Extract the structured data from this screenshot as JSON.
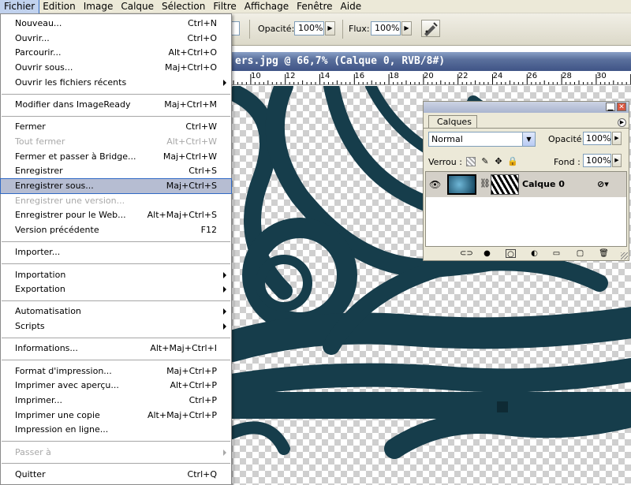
{
  "menubar": [
    {
      "label": "Fichier",
      "active": true
    },
    {
      "label": "Edition"
    },
    {
      "label": "Image"
    },
    {
      "label": "Calque"
    },
    {
      "label": "Sélection"
    },
    {
      "label": "Filtre"
    },
    {
      "label": "Affichage"
    },
    {
      "label": "Fenêtre"
    },
    {
      "label": "Aide"
    }
  ],
  "options": {
    "opacity_label": "Opacité:",
    "opacity_value": "100%",
    "flow_label": "Flux:",
    "flow_value": "100%",
    "airbrush_icon": "airbrush-icon"
  },
  "document": {
    "title": "ers.jpg @ 66,7% (Calque 0, RVB/8#)",
    "ruler_ticks": [
      "10",
      "12",
      "14",
      "16",
      "18",
      "20",
      "22",
      "24",
      "26",
      "28",
      "30"
    ]
  },
  "file_menu": [
    {
      "label": "Nouveau...",
      "shortcut": "Ctrl+N"
    },
    {
      "label": "Ouvrir...",
      "shortcut": "Ctrl+O"
    },
    {
      "label": "Parcourir...",
      "shortcut": "Alt+Ctrl+O"
    },
    {
      "label": "Ouvrir sous...",
      "shortcut": "Maj+Ctrl+O"
    },
    {
      "label": "Ouvrir les fichiers récents",
      "submenu": true
    },
    {
      "separator": true
    },
    {
      "label": "Modifier dans ImageReady",
      "shortcut": "Maj+Ctrl+M"
    },
    {
      "separator": true
    },
    {
      "label": "Fermer",
      "shortcut": "Ctrl+W"
    },
    {
      "label": "Tout fermer",
      "shortcut": "Alt+Ctrl+W",
      "disabled": true
    },
    {
      "label": "Fermer et passer à Bridge...",
      "shortcut": "Maj+Ctrl+W"
    },
    {
      "label": "Enregistrer",
      "shortcut": "Ctrl+S"
    },
    {
      "label": "Enregistrer sous...",
      "shortcut": "Maj+Ctrl+S",
      "highlighted": true
    },
    {
      "label": "Enregistrer une version...",
      "disabled": true
    },
    {
      "label": "Enregistrer pour le Web...",
      "shortcut": "Alt+Maj+Ctrl+S"
    },
    {
      "label": "Version précédente",
      "shortcut": "F12"
    },
    {
      "separator": true
    },
    {
      "label": "Importer..."
    },
    {
      "separator": true
    },
    {
      "label": "Importation",
      "submenu": true
    },
    {
      "label": "Exportation",
      "submenu": true
    },
    {
      "separator": true
    },
    {
      "label": "Automatisation",
      "submenu": true
    },
    {
      "label": "Scripts",
      "submenu": true
    },
    {
      "separator": true
    },
    {
      "label": "Informations...",
      "shortcut": "Alt+Maj+Ctrl+I"
    },
    {
      "separator": true
    },
    {
      "label": "Format d'impression...",
      "shortcut": "Maj+Ctrl+P"
    },
    {
      "label": "Imprimer avec aperçu...",
      "shortcut": "Alt+Ctrl+P"
    },
    {
      "label": "Imprimer...",
      "shortcut": "Ctrl+P"
    },
    {
      "label": "Imprimer une copie",
      "shortcut": "Alt+Maj+Ctrl+P"
    },
    {
      "label": "Impression en ligne..."
    },
    {
      "separator": true
    },
    {
      "label": "Passer à",
      "submenu": true,
      "disabled": true
    },
    {
      "separator": true
    },
    {
      "label": "Quitter",
      "shortcut": "Ctrl+Q"
    }
  ],
  "layers_panel": {
    "tab": "Calques",
    "blend_mode": "Normal",
    "opacity_label": "Opacité:",
    "opacity_value": "100%",
    "lock_label": "Verrou :",
    "fill_label": "Fond :",
    "fill_value": "100%",
    "layer_name": "Calque 0"
  }
}
